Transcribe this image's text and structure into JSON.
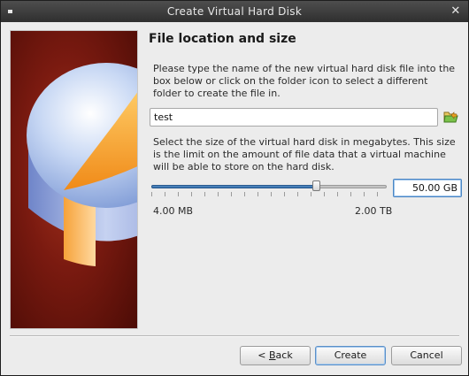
{
  "window": {
    "title": "Create Virtual Hard Disk"
  },
  "page": {
    "title": "File location and size",
    "location_description": "Please type the name of the new virtual hard disk file into the box below or click on the folder icon to select a different folder to create the file in.",
    "size_description": "Select the size of the virtual hard disk in megabytes. This size is the limit on the amount of file data that a virtual machine will be able to store on the hard disk."
  },
  "file_location": {
    "value": "test",
    "folder_icon": "folder-open-icon"
  },
  "size": {
    "value": "50.00 GB",
    "slider_fraction": 0.7,
    "min_label": "4.00 MB",
    "max_label": "2.00 TB"
  },
  "buttons": {
    "back_mnemonic": "B",
    "back_rest": "ack",
    "create": "Create",
    "cancel": "Cancel"
  },
  "colors": {
    "accent": "#2f6aa8",
    "titlebar": "#3a3a3a",
    "side_image_bg": "#7a1a10"
  }
}
